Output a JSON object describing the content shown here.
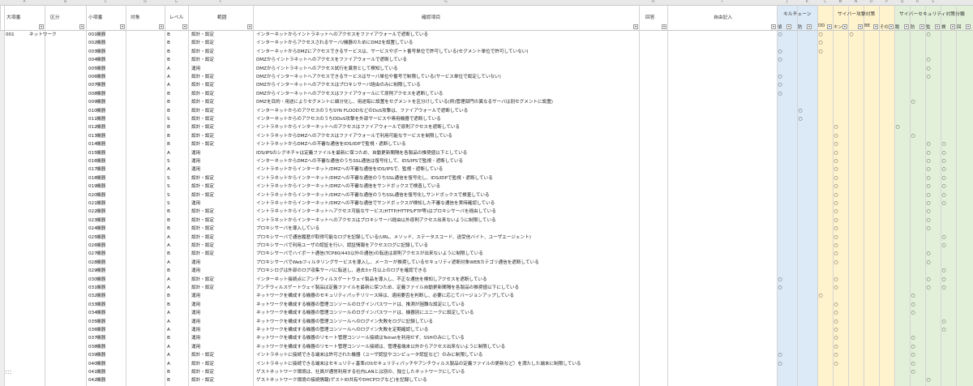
{
  "column_letters": [
    "A",
    "B",
    "C",
    "D",
    "E",
    "F",
    "G",
    "H",
    "I",
    "J",
    "K",
    "L",
    "M",
    "N",
    "O",
    "P",
    "Q",
    "R",
    "S"
  ],
  "headers": {
    "major": "大項番",
    "category": "区分",
    "minor": "小項番",
    "target": "対象",
    "level": "レベル",
    "scope": "範囲",
    "check_item": "確認項目",
    "answer": "回答",
    "free_entry": "自由記入",
    "group_kill_chain": "キルチェーン",
    "group_attack_method": "サイバー攻撃対策",
    "group_security": "サイバーセキュリティ対策分類"
  },
  "sub_headers": [
    {
      "label": "偵",
      "sel": "▾"
    },
    {
      "label": "防",
      "sel": "▾"
    },
    {
      "label": "DD",
      "sel": "▾"
    },
    {
      "label": "キン",
      "sel": "▾"
    },
    {
      "label": "",
      "sel": "▾"
    },
    {
      "label": "BE",
      "sel": "▾"
    },
    {
      "label": "その",
      "sel": "▾"
    },
    {
      "label": "脆",
      "sel": "▾"
    },
    {
      "label": "防",
      "sel": "▾"
    },
    {
      "label": "監",
      "sel": "▾"
    },
    {
      "label": "検",
      "sel": "▾"
    },
    {
      "label": "回",
      "sel": "▾"
    }
  ],
  "filter_glyph": "▾",
  "circle": "○",
  "first_row": {
    "major": "001",
    "category": "ネットワーク"
  },
  "continuation_marker": "：：：",
  "colors": {
    "kill_chain_bg": "#dce9f6",
    "attack_bg": "#fff3cd",
    "security_bg": "#e2f0d9",
    "header_bg": "#ffffff",
    "grid": "#d4d4d4"
  },
  "rows": [
    {
      "minor": "001",
      "target": "機器",
      "level": "B",
      "scope": "設計・設定",
      "text": "インターネットからイントラネットへのアクセスをファイアウォールで遮断している",
      "m": "10101000010"
    },
    {
      "minor": "002",
      "target": "機器",
      "level": "B",
      "scope": "設計・設定",
      "text": "インターネットからアクセスされるサーバ/機器のためにDMZを設置している",
      "m": "00100000000"
    },
    {
      "minor": "003",
      "target": "機器",
      "level": "B",
      "scope": "設計・設定",
      "text": "インターネットからDMZにアクセスできるサービスは、サービスやポート番号単位で許可している(セグメント単位で許可していない)",
      "m": "10100000000"
    },
    {
      "minor": "004",
      "target": "機器",
      "level": "B",
      "scope": "設計・設定",
      "text": "DMZからイントラネットへのアクセスをファイアウォールで遮断している",
      "m": "10000000010"
    },
    {
      "minor": "005",
      "target": "機器",
      "level": "A",
      "scope": "運用",
      "text": "DMZからイントラネットへのアクセス試行を異常として検知している",
      "m": "00000000010"
    },
    {
      "minor": "006",
      "target": "機器",
      "level": "A",
      "scope": "設計・設定",
      "text": "DMZからインターネットへアクセスできるサービスはサーバ単位や番号で制限している(サービス単位で設定していない)",
      "m": "10000000010"
    },
    {
      "minor": "007",
      "target": "機器",
      "level": "A",
      "scope": "設計・設定",
      "text": "DMZからインターネットへのアクセスはプロキシサーバ経由のみに制限している",
      "m": "10000000000"
    },
    {
      "minor": "008",
      "target": "機器",
      "level": "B",
      "scope": "設計・設定",
      "text": "DMZからインターネットへのアクセスはファイアウォールにて原則アクセスを遮断している",
      "m": "10000000000"
    },
    {
      "minor": "009",
      "target": "機器",
      "level": "B",
      "scope": "設計・設定",
      "text": "DMZを目的・用途によりセグメントに細分化し、用途毎に設置をセグメントを区分けしている(例)管理部門の異なるサーバは別セグメントに設置)",
      "m": "00000000100"
    },
    {
      "minor": "010",
      "target": "機器",
      "level": "B",
      "scope": "設計・設定",
      "text": "インターネットからのアクセスのうちSYN FLOODなどのDoS攻撃は、ファイアウォールで遮断している",
      "m": "01000000000"
    },
    {
      "minor": "011",
      "target": "機器",
      "level": "S",
      "scope": "設計・設定",
      "text": "インターネットからのアクセスのうちDDoS攻撃を外部サービスや専用機器で遮断している",
      "m": "01000000000"
    },
    {
      "minor": "012",
      "target": "機器",
      "level": "B",
      "scope": "設計・設定",
      "text": "イントラネットからインターネットへのアクセスはファイアウォールで原則アクセスを遮断している",
      "m": "00010001000"
    },
    {
      "minor": "013",
      "target": "機器",
      "level": "B",
      "scope": "設計・設定",
      "text": "イントラネットからDMZへのアクセスはファイアウォールで利用可能なサービスを制限している",
      "m": "00010000100"
    },
    {
      "minor": "014",
      "target": "機器",
      "level": "B",
      "scope": "設計・設定",
      "text": "イントラネットからDMZへの不審な通信をIDS/IDPで監視・遮断している",
      "m": "00010000011"
    },
    {
      "minor": "015",
      "target": "機器",
      "level": "A",
      "scope": "運用",
      "text": "IDS/IPSのシグネチャは定義ファイルを最新に保つため、自動更新間隔を各製品の推奨値以下としている",
      "m": "00010000011"
    },
    {
      "minor": "016",
      "target": "機器",
      "level": "S",
      "scope": "運用",
      "text": "インターネットからDMZへの不審な通信のうちSSL通信は復号化して、IDS/IPSで監視・遮断している",
      "m": "00010000011"
    },
    {
      "minor": "017",
      "target": "機器",
      "level": "A",
      "scope": "運用",
      "text": "イントラネットからインターネット/DMZへの不審な通信をIDS/IPSで、監視・遮断している",
      "m": "00010000011"
    },
    {
      "minor": "018",
      "target": "機器",
      "level": "S",
      "scope": "設計・設定",
      "text": "イントラネットからインターネット/DMZへの不審な通信のうちSSL通信を復号化し、IDS/IDPで監視・遮断している",
      "m": "00010000011"
    },
    {
      "minor": "019",
      "target": "機器",
      "level": "S",
      "scope": "設計・設定",
      "text": "イントラネットからインターネット/DMZへの不審な通信をサンドボックスで検査している",
      "m": "00010000011"
    },
    {
      "minor": "020",
      "target": "機器",
      "level": "S",
      "scope": "設計・設定",
      "text": "イントラネットからインターネット/DMZへの不審な通信のうちSSL通信を復号化しサンドボックスで検査している",
      "m": "00010000011"
    },
    {
      "minor": "021",
      "target": "機器",
      "level": "S",
      "scope": "運用",
      "text": "イントラネットからインターネット/DMZへの不審な通信でサンドボックスが検知した不審な通信を実時確認している",
      "m": "00010000011"
    },
    {
      "minor": "022",
      "target": "機器",
      "level": "B",
      "scope": "設計・設定",
      "text": "イントラネットからインターネットへアクセス可能なサービス(HTTP/HTTPS/FTP等)はプロキシサーバを経由している",
      "m": "00010000010"
    },
    {
      "minor": "023",
      "target": "機器",
      "level": "B",
      "scope": "設計・設定",
      "text": "イントラネットからインターネットへのアクセスはプロキシサーバ経由以外原則アクセス出来ないように制限している",
      "m": "00010000010"
    },
    {
      "minor": "024",
      "target": "機器",
      "level": "B",
      "scope": "設計・設定",
      "text": "プロキシサーバを導入している",
      "m": "00010000010"
    },
    {
      "minor": "025",
      "target": "機器",
      "level": "A",
      "scope": "設計・設定",
      "text": "プロキシサーバで通信履歴が取得可能なログを記録している(URL、メソッド、ステータスコード、送受信バイト、ユーザエージェント)",
      "m": "00010000001"
    },
    {
      "minor": "026",
      "target": "機器",
      "level": "A",
      "scope": "設計・設定",
      "text": "プロキシサーバで利用ユーザの認証を行い、認証情報をアクセスログに記録している",
      "m": "00010000001"
    },
    {
      "minor": "027",
      "target": "機器",
      "level": "B",
      "scope": "設計・設定",
      "text": "プロキシサーバでハイポート通信(TCP80/443以外の通信)の転送は原則アクセスが出来ないように制限している",
      "m": "00010000010"
    },
    {
      "minor": "028",
      "target": "機器",
      "level": "A",
      "scope": "運用",
      "text": "プロキシサーバでWebフィルタリングサービスを導入し、メーカーが推奨しているセキュリティ遮断対象WEBカテゴリ通信を遮断している",
      "m": "00010000010"
    },
    {
      "minor": "029",
      "target": "機器",
      "level": "B",
      "scope": "運用",
      "text": "プロキシログは外部のログ収集サーバに転送し、過去3ヶ月以上のログを確認できる",
      "m": "00000000001"
    },
    {
      "minor": "030",
      "target": "機器",
      "level": "A",
      "scope": "設計・設定",
      "text": "インターネット接続点にアンチウィルスゲートウェイ製品を導入し、不正な通信を検知しアクセスを遮断している",
      "m": "10010000011"
    },
    {
      "minor": "031",
      "target": "機器",
      "level": "A",
      "scope": "設計・設定",
      "text": "アンチウィルスゲートウェイ製品は定義ファイルを最新に保つため、定義ファイル自動更新間隔を各製品の推奨値以下にしている",
      "m": "10010000011"
    },
    {
      "minor": "032",
      "target": "機器",
      "level": "B",
      "scope": "運用",
      "text": "ネットワークを構成する機器のセキュリティパッチリリース時は、適用要否を判断し、必要に応じてバージョンアップしている",
      "m": "00100000100"
    },
    {
      "minor": "033",
      "target": "機器",
      "level": "B",
      "scope": "運用",
      "text": "ネットワークを構成する機器の管理コンソールのログインパスワードは、推測が困難な設定にしている",
      "m": "00010000100"
    },
    {
      "minor": "034",
      "target": "機器",
      "level": "A",
      "scope": "運用",
      "text": "ネットワークを構成する機器の管理コンソールのログインパスワードは、機器別にユニークに設定している",
      "m": "00010000100"
    },
    {
      "minor": "035",
      "target": "機器",
      "level": "A",
      "scope": "運用",
      "text": "ネットワークを構成する機器の管理コンソールへのログイン失敗をログに記録している",
      "m": "00010000001"
    },
    {
      "minor": "036",
      "target": "機器",
      "level": "A",
      "scope": "運用",
      "text": "ネットワークを構成する機器の管理コンソールへのログイン失敗を定期確認している",
      "m": "00010000001"
    },
    {
      "minor": "037",
      "target": "機器",
      "level": "B",
      "scope": "運用",
      "text": "ネットワークを構成する機器のリモート管理コンソール接続はTelnetを利用せず、SSHのみにしている",
      "m": "00010000100"
    },
    {
      "minor": "038",
      "target": "機器",
      "level": "A",
      "scope": "運用",
      "text": "ネットワークを構成する機器のリモート管理コンソール接続は、管理者端末以外からアクセス出来ないように制限している",
      "m": "00010000100"
    },
    {
      "minor": "039",
      "target": "機器",
      "level": "A",
      "scope": "設計・設定",
      "text": "イントラネットに接続できる端末は許可された機器（ユーザ認証やコンピュータ認証など）のみに制限している",
      "m": "10010000100"
    },
    {
      "minor": "040",
      "target": "機器",
      "level": "A",
      "scope": "設計・設定",
      "text": "イントラネットに接続できる端末はセキュリティ基準(OSセキュリティパッチやアンチウィルス製品の定義ファイルの更新など）を満たした端末に制限している",
      "m": "10010000100"
    },
    {
      "minor": "041",
      "target": "機器",
      "level": "B",
      "scope": "設計・設定",
      "text": "ゲストネットワーク環境は、社員が通常利用する社内LANとは別の、独立したネットワークにしている",
      "m": "00000000100"
    },
    {
      "minor": "042",
      "target": "機器",
      "level": "B",
      "scope": "設計・設定",
      "text": "ゲストネットワーク環境の接続情報(ゲストID共有やDHCPログなど)を記録している",
      "m": "00000000010"
    },
    {
      "minor": "043",
      "target": "機器",
      "level": "B",
      "scope": "設計・設定",
      "text": "ゲストネットワーク環境の通信ログを記録している",
      "m": "00000000010"
    }
  ]
}
